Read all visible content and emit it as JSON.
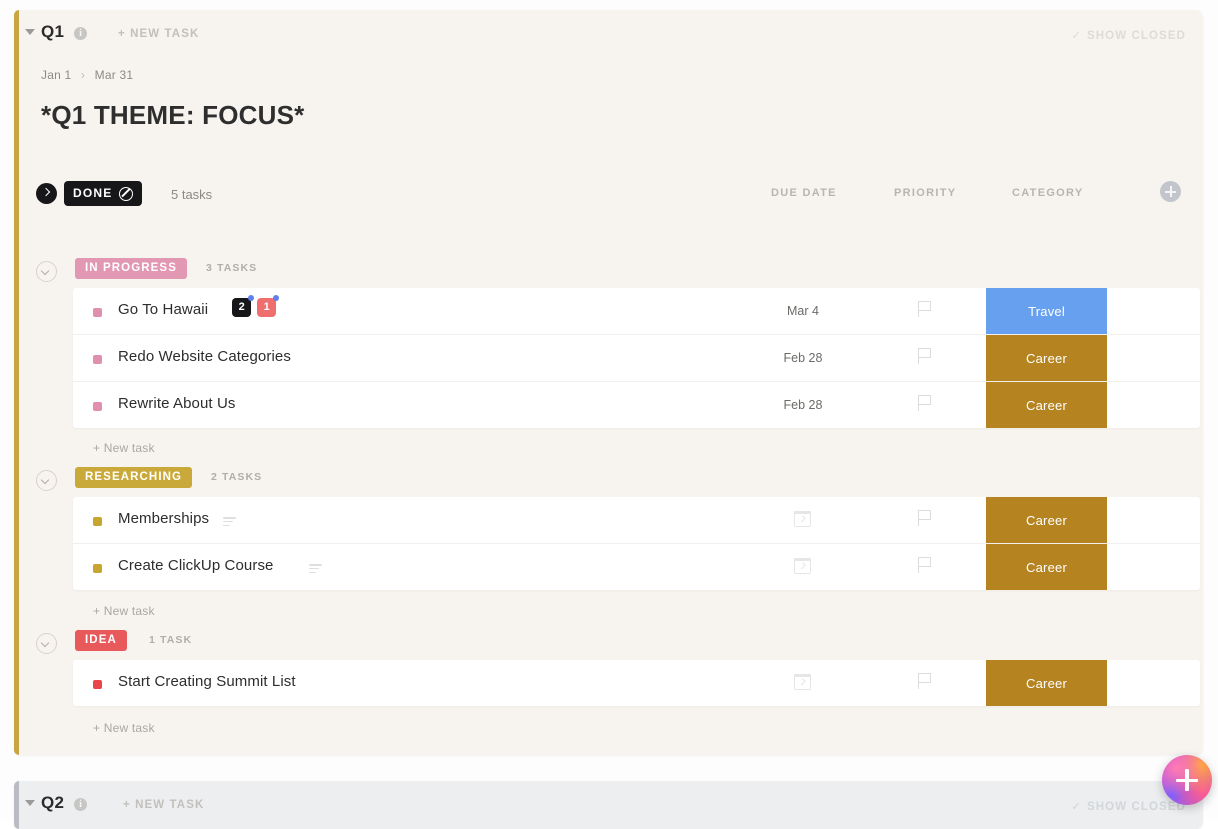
{
  "quarters": [
    {
      "id": "q1",
      "title": "Q1",
      "info_icon": "info-icon",
      "new_task_label": "+ NEW TASK",
      "show_closed_label": "SHOW CLOSED",
      "show_closed_check": "✓",
      "date_start": "Jan 1",
      "date_separator": "›",
      "date_end": "Mar 31",
      "theme": "*Q1 THEME: FOCUS*",
      "accent_color": "#c9a542",
      "background_color": "#f7f4ef"
    },
    {
      "id": "q2",
      "title": "Q2",
      "info_icon": "info-icon",
      "new_task_label": "+ NEW TASK",
      "show_closed_label": "SHOW CLOSED",
      "show_closed_check": "✓",
      "accent_color": "#b9bcc2",
      "background_color": "#eceef0"
    }
  ],
  "columns": {
    "due_date": "DUE DATE",
    "priority": "PRIORITY",
    "category": "CATEGORY",
    "add_column_icon": "plus-icon"
  },
  "done_group": {
    "label": "DONE",
    "icon": "circle-slash-icon",
    "count_label": "5 tasks",
    "collapsed": true,
    "color": "#17171a"
  },
  "new_task_inline_label": "+ New task",
  "groups": [
    {
      "status": "IN PROGRESS",
      "status_color": "#e297b2",
      "dot_color": "#e08fae",
      "count_label": "3 TASKS",
      "tasks": [
        {
          "name": "Go To Hawaii",
          "due": "Mar 4",
          "has_due": true,
          "priority_icon": "flag-icon",
          "category": "Travel",
          "category_color": "#67a0ef",
          "chips": [
            {
              "label": "2",
              "bg": "#17171a",
              "dot": "#5f7ef2",
              "name": "subtask-count-chip"
            },
            {
              "label": "1",
              "bg": "#ef6f6f",
              "dot": "#5f7ef2",
              "name": "checklist-count-chip"
            }
          ],
          "has_description": false
        },
        {
          "name": "Redo Website Categories",
          "due": "Feb 28",
          "has_due": true,
          "priority_icon": "flag-icon",
          "category": "Career",
          "category_color": "#b5831f",
          "chips": [],
          "has_description": false
        },
        {
          "name": "Rewrite About Us",
          "due": "Feb 28",
          "has_due": true,
          "priority_icon": "flag-icon",
          "category": "Career",
          "category_color": "#b5831f",
          "chips": [],
          "has_description": false
        }
      ]
    },
    {
      "status": "RESEARCHING",
      "status_color": "#c9a93a",
      "dot_color": "#c6a62f",
      "count_label": "2 TASKS",
      "tasks": [
        {
          "name": "Memberships",
          "due": "",
          "has_due": false,
          "priority_icon": "flag-icon",
          "category": "Career",
          "category_color": "#b5831f",
          "chips": [],
          "has_description": true
        },
        {
          "name": "Create ClickUp Course",
          "due": "",
          "has_due": false,
          "priority_icon": "flag-icon",
          "category": "Career",
          "category_color": "#b5831f",
          "chips": [],
          "has_description": true
        }
      ]
    },
    {
      "status": "IDEA",
      "status_color": "#e8595b",
      "dot_color": "#e8464a",
      "count_label": "1 TASK",
      "tasks": [
        {
          "name": "Start Creating Summit List",
          "due": "",
          "has_due": false,
          "priority_icon": "flag-icon",
          "category": "Career",
          "category_color": "#b5831f",
          "chips": [],
          "has_description": false
        }
      ]
    }
  ],
  "fab": {
    "icon": "plus-icon",
    "name": "create-button"
  }
}
